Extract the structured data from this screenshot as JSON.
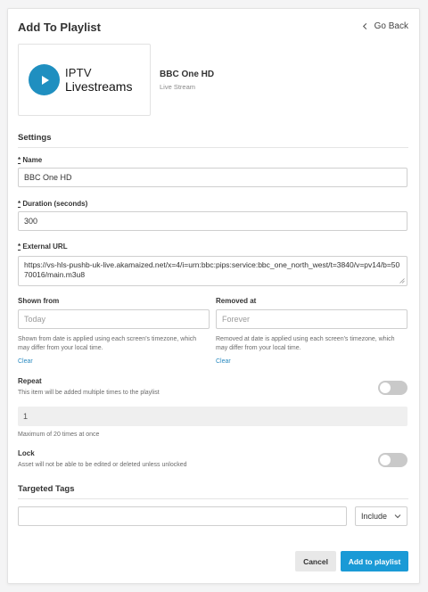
{
  "header": {
    "title": "Add To Playlist",
    "back_label": "Go Back"
  },
  "asset": {
    "logo_line1": "IPTV",
    "logo_line2": "Livestreams",
    "name": "BBC One HD",
    "type": "Live Stream"
  },
  "settings": {
    "section_title": "Settings",
    "required_marker": "*",
    "name": {
      "label": "Name",
      "value": "BBC One HD"
    },
    "duration": {
      "label": "Duration (seconds)",
      "value": "300"
    },
    "external_url": {
      "label": "External URL",
      "value": "https://vs-hls-pushb-uk-live.akamaized.net/x=4/i=urn:bbc:pips:service:bbc_one_north_west/t=3840/v=pv14/b=5070016/main.m3u8"
    },
    "shown_from": {
      "label": "Shown from",
      "placeholder": "Today",
      "help": "Shown from date is applied using each screen's timezone, which may differ from your local time.",
      "clear": "Clear"
    },
    "removed_at": {
      "label": "Removed at",
      "placeholder": "Forever",
      "help": "Removed at date is applied using each screen's timezone, which may differ from your local time.",
      "clear": "Clear"
    },
    "repeat": {
      "label": "Repeat",
      "help": "This item will be added multiple times to the playlist",
      "enabled": false,
      "count": "1",
      "max_note": "Maximum of 20 times at once"
    },
    "lock": {
      "label": "Lock",
      "help": "Asset will not be able to be edited or deleted unless unlocked",
      "enabled": false
    }
  },
  "tags": {
    "section_title": "Targeted Tags",
    "input_value": "",
    "mode": "Include"
  },
  "actions": {
    "cancel": "Cancel",
    "add": "Add to playlist"
  },
  "colors": {
    "accent": "#1a9ad6",
    "logo": "#1f8fc0",
    "link": "#2a8ac0"
  }
}
